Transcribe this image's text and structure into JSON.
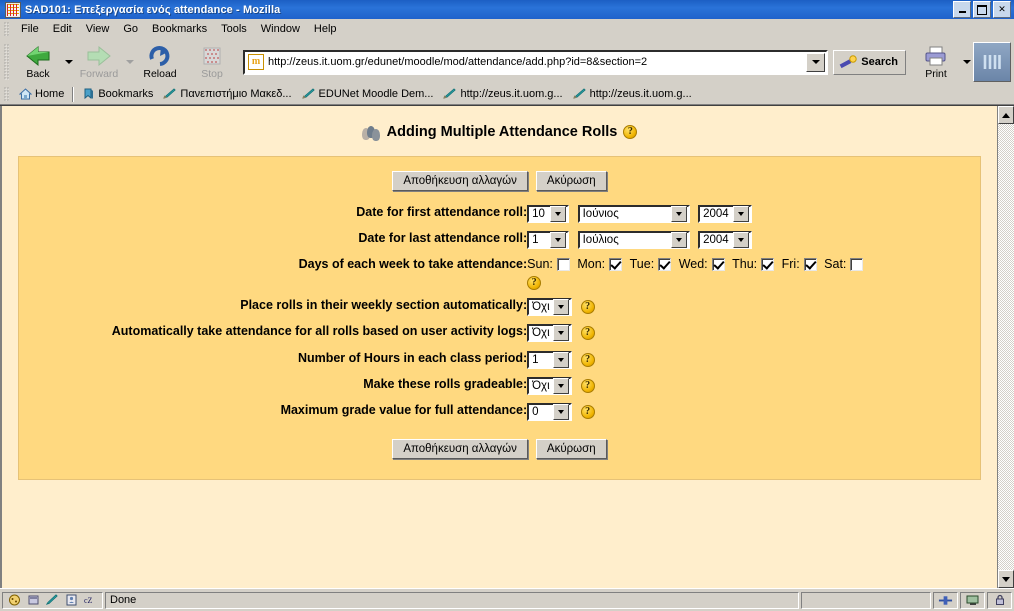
{
  "window": {
    "title": "SAD101: Επεξεργασία ενός attendance - Mozilla",
    "minimize_label": "Minimize",
    "maximize_label": "Maximize",
    "close_label": "✕"
  },
  "menu": {
    "items": [
      "File",
      "Edit",
      "View",
      "Go",
      "Bookmarks",
      "Tools",
      "Window",
      "Help"
    ]
  },
  "toolbar": {
    "back_label": "Back",
    "forward_label": "Forward",
    "reload_label": "Reload",
    "stop_label": "Stop",
    "search_label": "Search",
    "print_label": "Print",
    "url": "http://zeus.it.uom.gr/edunet/moodle/mod/attendance/add.php?id=8&section=2",
    "favicon_text": "m"
  },
  "personal_bar": {
    "items": [
      {
        "label": "Home",
        "icon": "home-icon"
      },
      {
        "label": "Bookmarks",
        "icon": "bookmarks-icon"
      },
      {
        "label": "Πανεπιστήμιο Μακεδ...",
        "icon": "bookmark-icon"
      },
      {
        "label": "EDUNet Moodle Dem...",
        "icon": "bookmark-icon"
      },
      {
        "label": "http://zeus.it.uom.g...",
        "icon": "bookmark-icon"
      },
      {
        "label": "http://zeus.it.uom.g...",
        "icon": "bookmark-icon"
      }
    ]
  },
  "page": {
    "title": "Adding Multiple Attendance Rolls",
    "help_glyph": "?",
    "background_color": "#FFEECC",
    "panel_color": "#FFD980"
  },
  "buttons": {
    "save_label": "Αποθήκευση αλλαγών",
    "cancel_label": "Ακύρωση"
  },
  "form": {
    "first_date": {
      "label": "Date for first attendance roll:",
      "day": "10",
      "month": "Ιούνιος",
      "year": "2004"
    },
    "last_date": {
      "label": "Date for last attendance roll:",
      "day": "1",
      "month": "Ιούλιος",
      "year": "2004"
    },
    "days_of_week": {
      "label": "Days of each week to take attendance:",
      "days": [
        {
          "name": "Sun:",
          "checked": false
        },
        {
          "name": "Mon:",
          "checked": true
        },
        {
          "name": "Tue:",
          "checked": true
        },
        {
          "name": "Wed:",
          "checked": true
        },
        {
          "name": "Thu:",
          "checked": true
        },
        {
          "name": "Fri:",
          "checked": true
        },
        {
          "name": "Sat:",
          "checked": false
        }
      ]
    },
    "weekly_section": {
      "label": "Place rolls in their weekly section automatically:",
      "value": "Όχι"
    },
    "auto_attendance": {
      "label": "Automatically take attendance for all rolls based on user activity logs:",
      "value": "Όχι"
    },
    "hours": {
      "label": "Number of Hours in each class period:",
      "value": "1"
    },
    "gradeable": {
      "label": "Make these rolls gradeable:",
      "value": "Όχι"
    },
    "max_grade": {
      "label": "Maximum grade value for full attendance:",
      "value": "0"
    }
  },
  "statusbar": {
    "status_text": "Done",
    "blank_text": ""
  }
}
